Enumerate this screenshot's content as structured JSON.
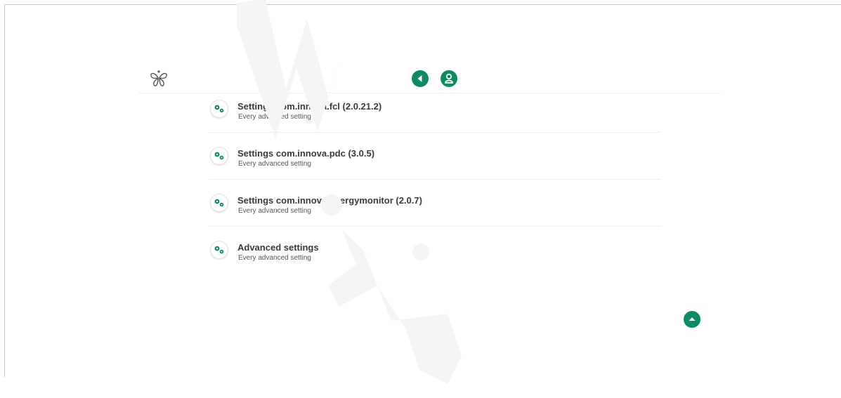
{
  "app": {
    "accent_color": "#0f8a66",
    "logo_icon": "butterfly-icon"
  },
  "header": {
    "back_icon": "back-arrow-icon",
    "user_icon": "user-icon"
  },
  "settings_list": [
    {
      "title": "Settings com.innova.fcl (2.0.21.2)",
      "subtitle": "Every advanced setting",
      "icon": "gears-icon"
    },
    {
      "title": "Settings com.innova.pdc (3.0.5)",
      "subtitle": "Every advanced setting",
      "icon": "gears-icon"
    },
    {
      "title": "Settings com.innova.energymonitor (2.0.7)",
      "subtitle": "Every advanced setting",
      "icon": "gears-icon"
    },
    {
      "title": "Advanced settings",
      "subtitle": "Every advanced setting",
      "icon": "gears-icon"
    }
  ],
  "footer": {
    "scroll_top_icon": "scroll-to-top-icon"
  }
}
